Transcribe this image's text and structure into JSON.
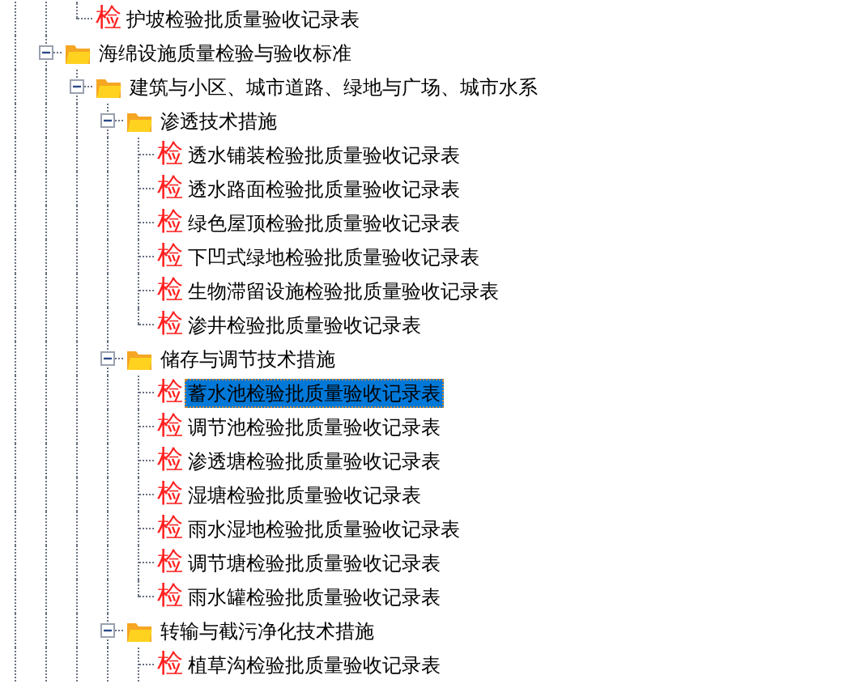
{
  "tree": {
    "cut_off_group": [
      {
        "kind": "leaf",
        "icon": "检",
        "label": "护坡检验批质量验收记录表",
        "selected": false
      }
    ],
    "nodes": [
      {
        "kind": "folder",
        "label": "海绵设施质量检验与验收标准",
        "expanded": true,
        "selected": false,
        "children": [
          {
            "kind": "folder",
            "label": "建筑与小区、城市道路、绿地与广场、城市水系",
            "expanded": true,
            "selected": false,
            "children": [
              {
                "kind": "folder",
                "label": "渗透技术措施",
                "expanded": true,
                "selected": false,
                "children": [
                  {
                    "kind": "leaf",
                    "icon": "检",
                    "label": "透水铺装检验批质量验收记录表",
                    "selected": false
                  },
                  {
                    "kind": "leaf",
                    "icon": "检",
                    "label": "透水路面检验批质量验收记录表",
                    "selected": false
                  },
                  {
                    "kind": "leaf",
                    "icon": "检",
                    "label": "绿色屋顶检验批质量验收记录表",
                    "selected": false
                  },
                  {
                    "kind": "leaf",
                    "icon": "检",
                    "label": "下凹式绿地检验批质量验收记录表",
                    "selected": false
                  },
                  {
                    "kind": "leaf",
                    "icon": "检",
                    "label": "生物滞留设施检验批质量验收记录表",
                    "selected": false
                  },
                  {
                    "kind": "leaf",
                    "icon": "检",
                    "label": "渗井检验批质量验收记录表",
                    "selected": false
                  }
                ]
              },
              {
                "kind": "folder",
                "label": "储存与调节技术措施",
                "expanded": true,
                "selected": false,
                "children": [
                  {
                    "kind": "leaf",
                    "icon": "检",
                    "label": "蓄水池检验批质量验收记录表",
                    "selected": true
                  },
                  {
                    "kind": "leaf",
                    "icon": "检",
                    "label": "调节池检验批质量验收记录表",
                    "selected": false
                  },
                  {
                    "kind": "leaf",
                    "icon": "检",
                    "label": "渗透塘检验批质量验收记录表",
                    "selected": false
                  },
                  {
                    "kind": "leaf",
                    "icon": "检",
                    "label": "湿塘检验批质量验收记录表",
                    "selected": false
                  },
                  {
                    "kind": "leaf",
                    "icon": "检",
                    "label": "雨水湿地检验批质量验收记录表",
                    "selected": false
                  },
                  {
                    "kind": "leaf",
                    "icon": "检",
                    "label": "调节塘检验批质量验收记录表",
                    "selected": false
                  },
                  {
                    "kind": "leaf",
                    "icon": "检",
                    "label": "雨水罐检验批质量验收记录表",
                    "selected": false
                  }
                ]
              },
              {
                "kind": "folder",
                "label": "转输与截污净化技术措施",
                "expanded": true,
                "selected": false,
                "children": [
                  {
                    "kind": "leaf",
                    "icon": "检",
                    "label": "植草沟检验批质量验收记录表",
                    "selected": false
                  }
                ]
              }
            ]
          }
        ]
      }
    ]
  }
}
